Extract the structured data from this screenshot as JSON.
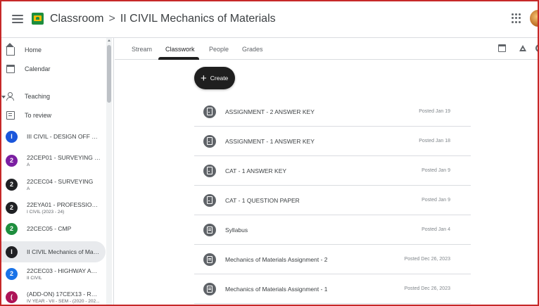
{
  "header": {
    "app_name": "Classroom",
    "separator": ">",
    "course_title": "II CIVIL Mechanics of Materials"
  },
  "sidebar": {
    "home_label": "Home",
    "calendar_label": "Calendar",
    "teaching_label": "Teaching",
    "to_review_label": "To review",
    "courses": [
      {
        "badge": "I",
        "name": "III CIVIL - DESIGN OFF STE...",
        "sub": "",
        "color": "#1a56db"
      },
      {
        "badge": "2",
        "name": "22CEP01 - SURVEYING LA...",
        "sub": "A",
        "color": "#7b1fa2"
      },
      {
        "badge": "2",
        "name": "22CEC04 - SURVEYING",
        "sub": "A",
        "color": "#202124"
      },
      {
        "badge": "2",
        "name": "22EYA01 - PROFESSIONAL ...",
        "sub": "I CIVIL (2023 - 24)",
        "color": "#202124"
      },
      {
        "badge": "2",
        "name": "22CEC05 - CMP",
        "sub": "",
        "color": "#1e8e3e"
      },
      {
        "badge": "I",
        "name": "II CIVIL Mechanics of Mate...",
        "sub": "",
        "color": "#202124"
      },
      {
        "badge": "2",
        "name": "22CEC03 - HIGHWAY AND...",
        "sub": "II CIVIL",
        "color": "#1a73e8"
      },
      {
        "badge": "(",
        "name": "(ADD-ON) 17CEX13 - REPA...",
        "sub": "IV YEAR - VII - SEM - (2020 - 202...",
        "color": "#ad1457"
      }
    ]
  },
  "tabs": [
    "Stream",
    "Classwork",
    "People",
    "Grades"
  ],
  "active_tab": "Classwork",
  "create_label": "Create",
  "items": [
    {
      "kind": "assignment",
      "title": "ASSIGNMENT - 2 ANSWER KEY",
      "date": "Posted Jan 19"
    },
    {
      "kind": "assignment",
      "title": "ASSIGNMENT - 1 ANSWER KEY",
      "date": "Posted Jan 18"
    },
    {
      "kind": "assignment",
      "title": "CAT - 1 ANSWER KEY",
      "date": "Posted Jan 9"
    },
    {
      "kind": "assignment",
      "title": "CAT - 1 QUESTION PAPER",
      "date": "Posted Jan 9"
    },
    {
      "kind": "material",
      "title": "Syllabus",
      "date": "Posted Jan 4"
    },
    {
      "kind": "material",
      "title": "Mechanics of Materials Assignment - 2",
      "date": "Posted Dec 26, 2023"
    },
    {
      "kind": "material",
      "title": "Mechanics of Materials Assignment - 1",
      "date": "Posted Dec 26, 2023"
    }
  ],
  "colors": {
    "accent": "#1f1f1f",
    "frame": "#c62828",
    "classroom_green": "#1e8e3e"
  },
  "icons": {
    "menu": "hamburger-menu-icon",
    "logo": "classroom-logo-icon",
    "apps": "apps-grid-icon",
    "calendar": "calendar-icon",
    "drive": "drive-icon",
    "settings": "gear-icon"
  }
}
